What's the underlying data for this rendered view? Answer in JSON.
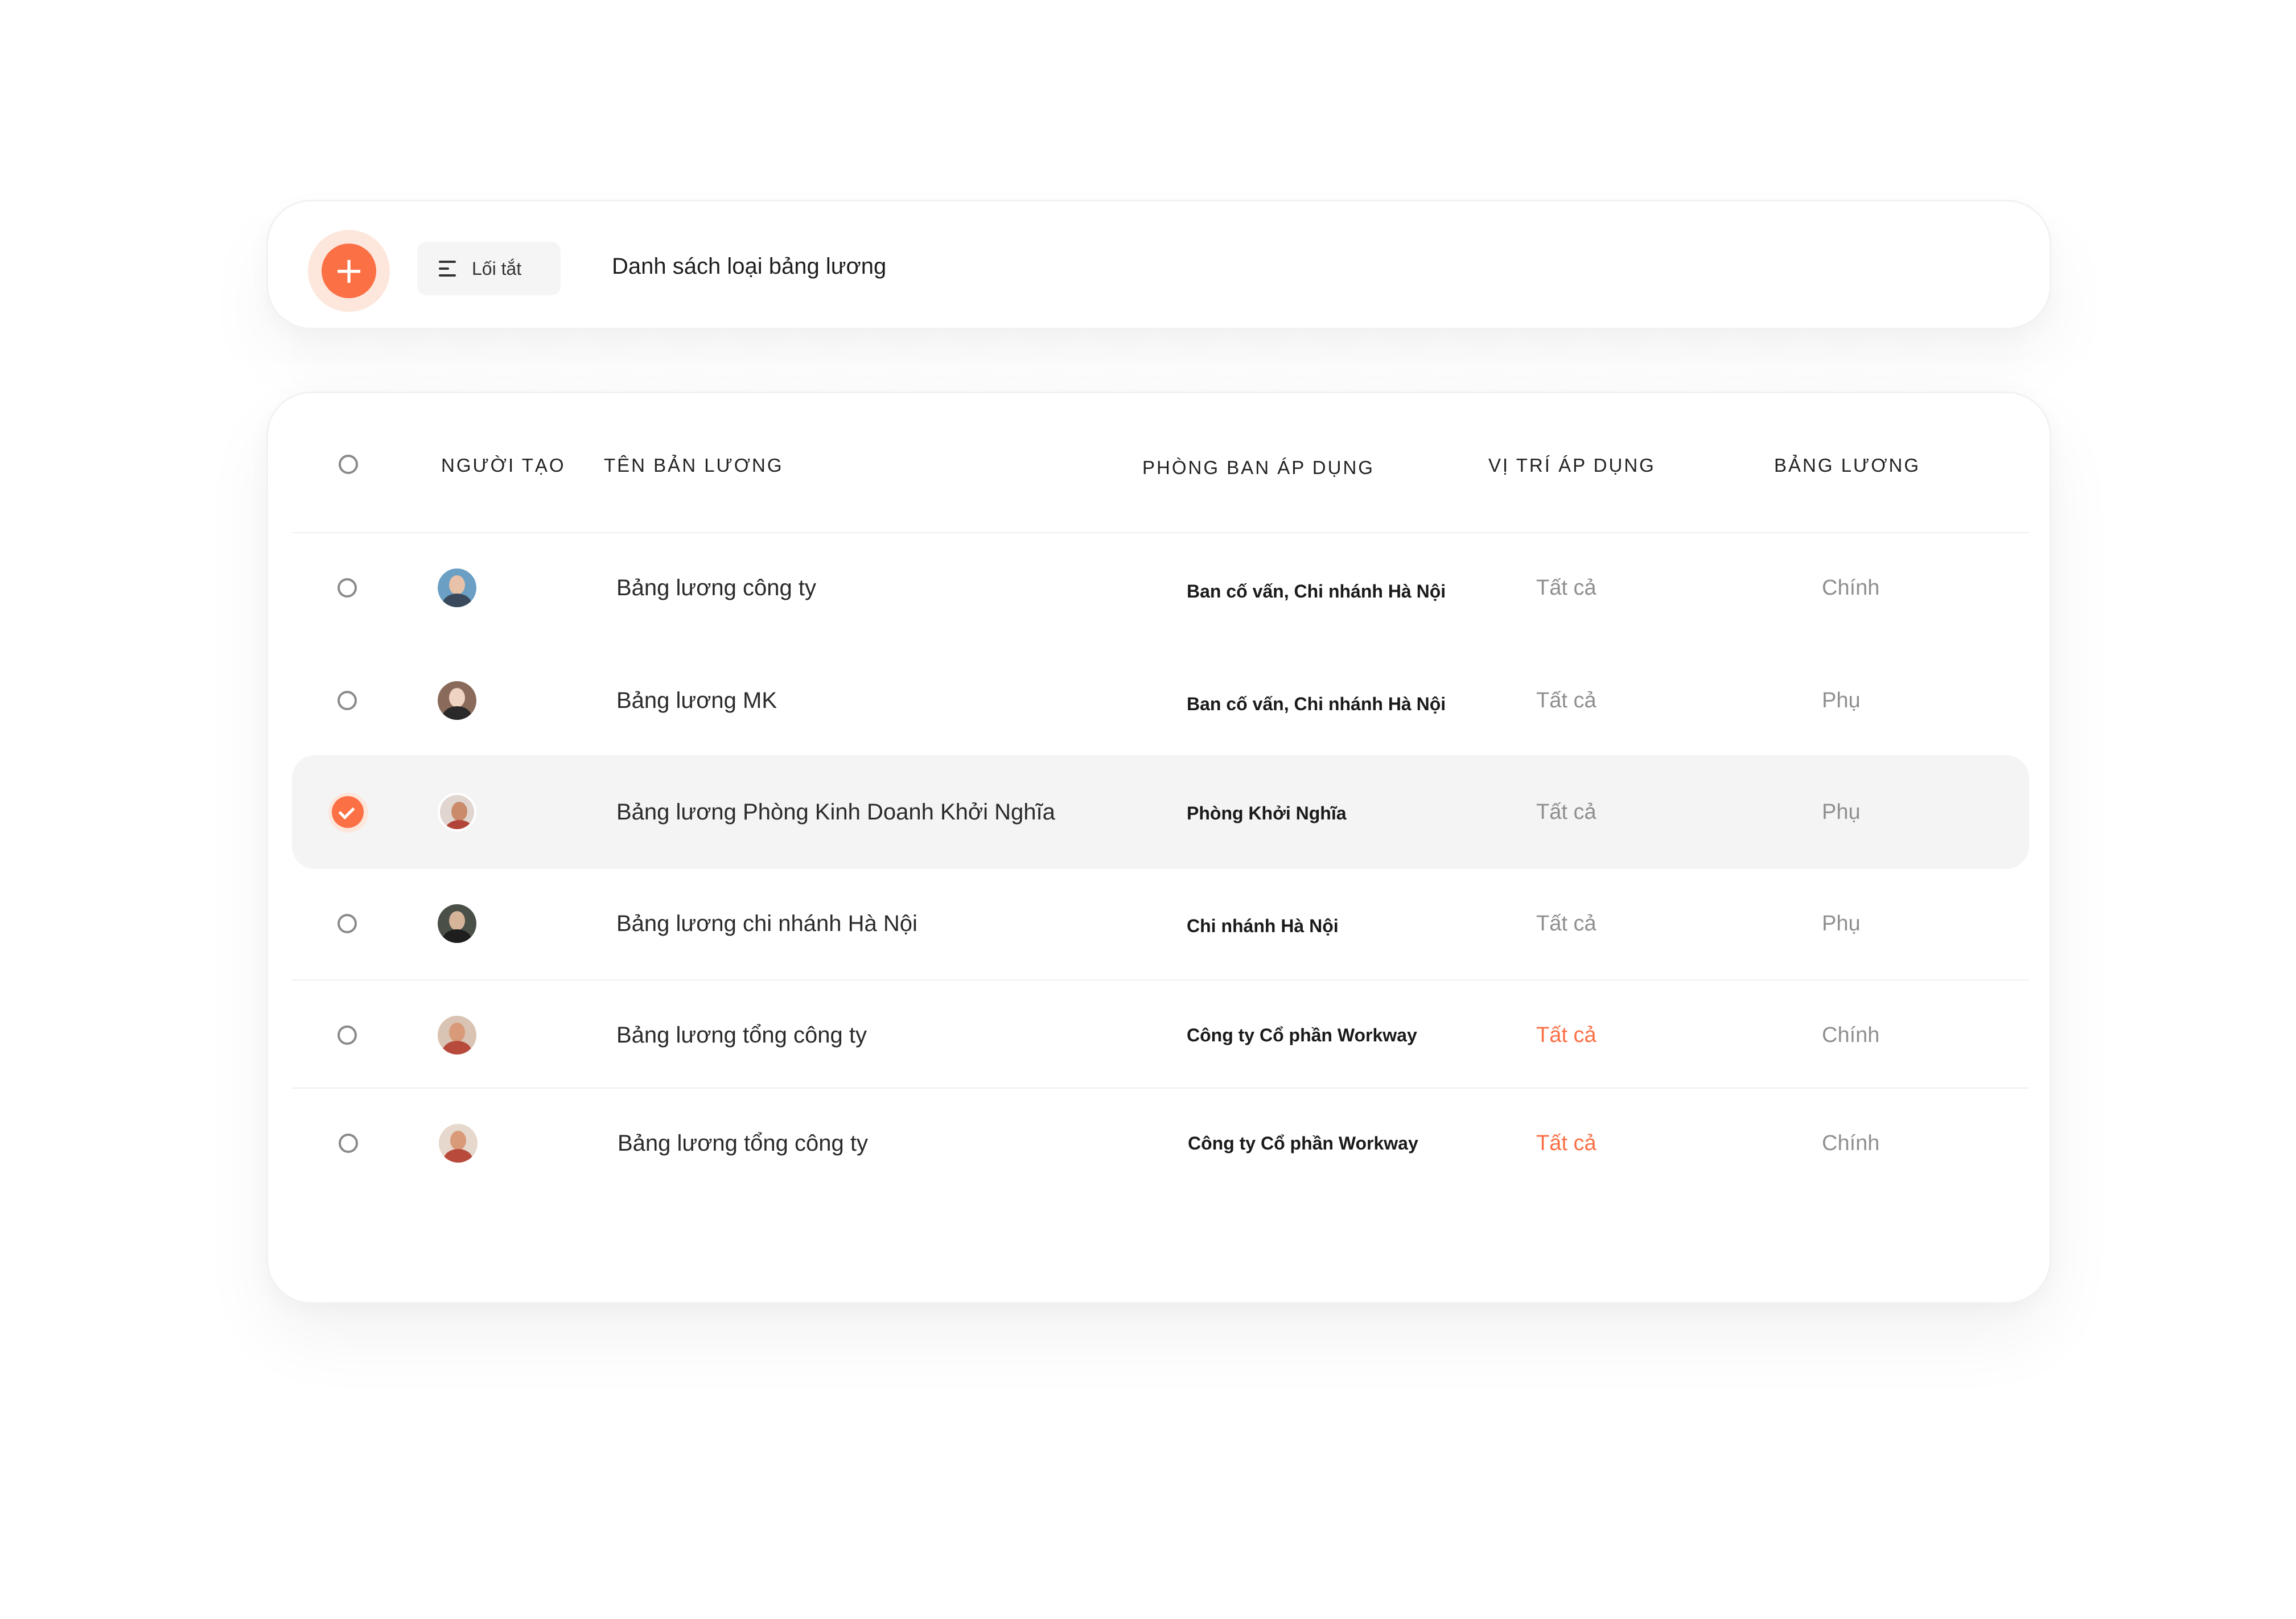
{
  "toolbar": {
    "add_icon": "+",
    "shortcut_label": "Lối tắt",
    "title": "Danh sách loại bảng lương"
  },
  "table": {
    "headers": {
      "creator": "NGƯỜI TẠO",
      "name": "TÊN BẢN LƯƠNG",
      "department": "PHÒNG BAN ÁP DỤNG",
      "position": "VỊ TRÍ ÁP DỤNG",
      "type": "BẢNG LƯƠNG"
    },
    "rows": [
      {
        "name": "Bảng lương công ty",
        "department": "Ban cố vấn, Chi nhánh Hà Nội",
        "position": "Tất cả",
        "type": "Chính",
        "selected": false
      },
      {
        "name": "Bảng lương MK",
        "department": "Ban cố vấn, Chi nhánh Hà Nội",
        "position": "Tất cả",
        "type": "Phụ",
        "selected": false
      },
      {
        "name": "Bảng lương Phòng Kinh Doanh Khởi Nghĩa",
        "department": "Phòng Khởi Nghĩa",
        "position": "Tất cả",
        "type": "Phụ",
        "selected": true
      },
      {
        "name": "Bảng lương chi nhánh Hà Nội",
        "department": "Chi nhánh Hà Nội",
        "position": "Tất cả",
        "type": "Phụ",
        "selected": false
      },
      {
        "name": "Bảng lương tổng công ty",
        "department": "Công ty Cổ phần Workway",
        "position": "Tất cả",
        "type": "Chính",
        "selected": false
      },
      {
        "name": "Bảng lương tổng công ty",
        "department": "Công ty Cổ phần Workway",
        "position": "Tất cả",
        "type": "Chính",
        "selected": false
      }
    ]
  },
  "colors": {
    "accent": "#fb7045",
    "muted_text": "#8f8f8f",
    "selected_row_bg": "#f4f4f4"
  },
  "icons": {
    "add": "plus-icon",
    "shortcut": "menu-lines-icon",
    "check": "checkmark-icon",
    "avatar": "user-photo-avatar"
  }
}
